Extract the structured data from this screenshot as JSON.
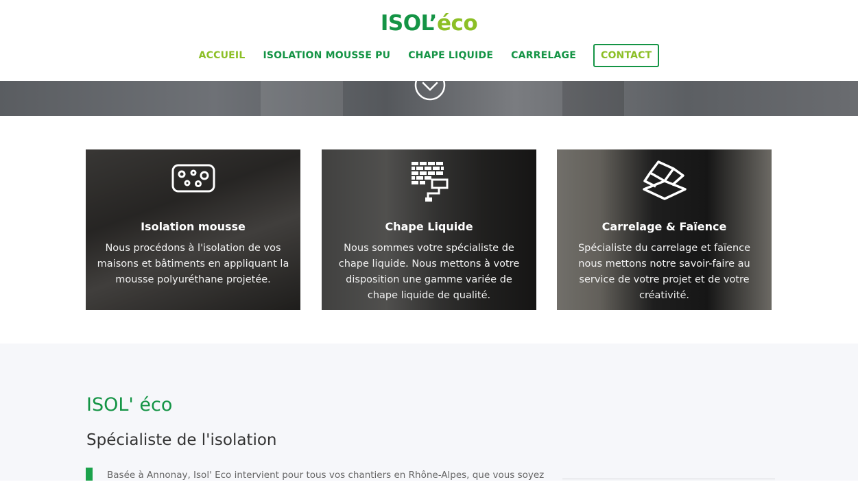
{
  "brand": {
    "logo_part1": "ISOL’",
    "logo_part2": "éco"
  },
  "nav": {
    "items": [
      {
        "label": "ACCUEIL"
      },
      {
        "label": "ISOLATION MOUSSE PU"
      },
      {
        "label": "CHAPE LIQUIDE"
      },
      {
        "label": "CARRELAGE"
      },
      {
        "label": "CONTACT"
      }
    ]
  },
  "hero": {
    "scroll_icon": "chevron-down-circle-icon"
  },
  "services": [
    {
      "title": "Isolation mousse",
      "text": "Nous procédons à l'isolation de vos maisons et bâtiments en appliquant la mousse polyuréthane projetée.",
      "icon": "foam-sponge-icon"
    },
    {
      "title": "Chape Liquide",
      "text": "Nous sommes votre spécialiste de chape liquide. Nous mettons à votre disposition une gamme variée de chape liquide de qualité.",
      "icon": "brick-trowel-icon"
    },
    {
      "title": "Carrelage & Faïence",
      "text": "Spécialiste du carrelage et faïence nous mettons notre savoir-faire au service de votre projet et de votre créativité.",
      "icon": "tiles-icon"
    }
  ],
  "about": {
    "heading": "ISOL' éco",
    "subheading": "Spécialiste de l'isolation",
    "intro": "Basée à Annonay, Isol' Eco intervient pour tous vos chantiers en Rhône-Alpes, que vous soyez"
  },
  "colors": {
    "green": "#149445",
    "lime": "#8cbf26",
    "background": "#f6f7fa"
  }
}
